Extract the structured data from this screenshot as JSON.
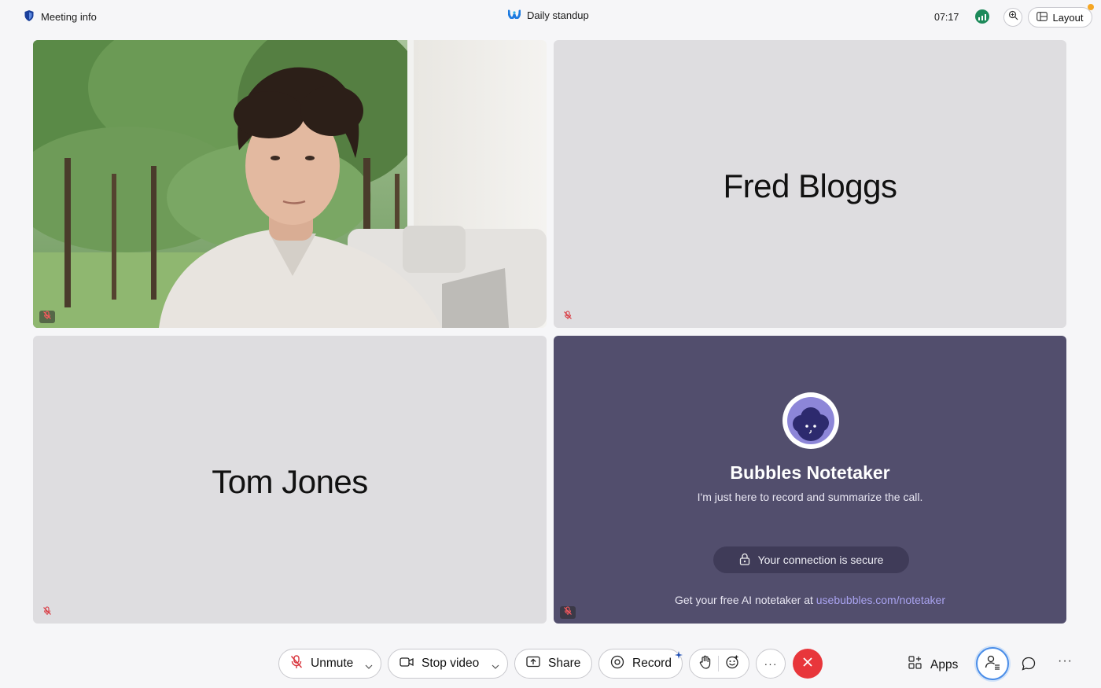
{
  "topbar": {
    "meeting_info_label": "Meeting info",
    "meeting_title": "Daily standup",
    "clock": "07:17",
    "layout_label": "Layout"
  },
  "tiles": [
    {
      "type": "video",
      "muted": true
    },
    {
      "type": "name",
      "name": "Fred Bloggs",
      "muted": true
    },
    {
      "type": "name",
      "name": "Tom Jones",
      "muted": true
    },
    {
      "type": "bot",
      "name": "Bubbles Notetaker",
      "subtitle": "I'm just here to record and summarize the call.",
      "secure_label": "Your connection is secure",
      "footer_prefix": "Get your free AI notetaker at",
      "footer_link": "usebubbles.com/notetaker",
      "muted": true
    }
  ],
  "toolbar": {
    "unmute_label": "Unmute",
    "stop_video_label": "Stop video",
    "share_label": "Share",
    "record_label": "Record",
    "more_label": "···",
    "apps_label": "Apps",
    "overflow_label": "···"
  },
  "colors": {
    "background": "#f6f6f8",
    "tile_gray": "#dedde0",
    "bot_tile": "#524e6d",
    "leave_red": "#e8363b",
    "mute_red": "#d9363e",
    "accent_blue": "#4a8de8",
    "link_purple": "#a9a3f0",
    "signal_green": "#1d8a5a"
  },
  "icons": {
    "meeting_info": "shield-icon",
    "title": "webex-logo-icon",
    "signal": "signal-bars-icon",
    "zoom": "zoom-in-icon",
    "layout": "layout-grid-icon",
    "mic_off": "mic-off-icon",
    "camera": "camera-icon",
    "share": "share-screen-icon",
    "record": "record-icon",
    "raise_hand": "hand-icon",
    "reactions": "emoji-icon",
    "leave": "close-icon",
    "apps": "apps-icon",
    "participants": "participants-icon",
    "chat": "chat-bubble-icon",
    "lock": "lock-icon"
  }
}
